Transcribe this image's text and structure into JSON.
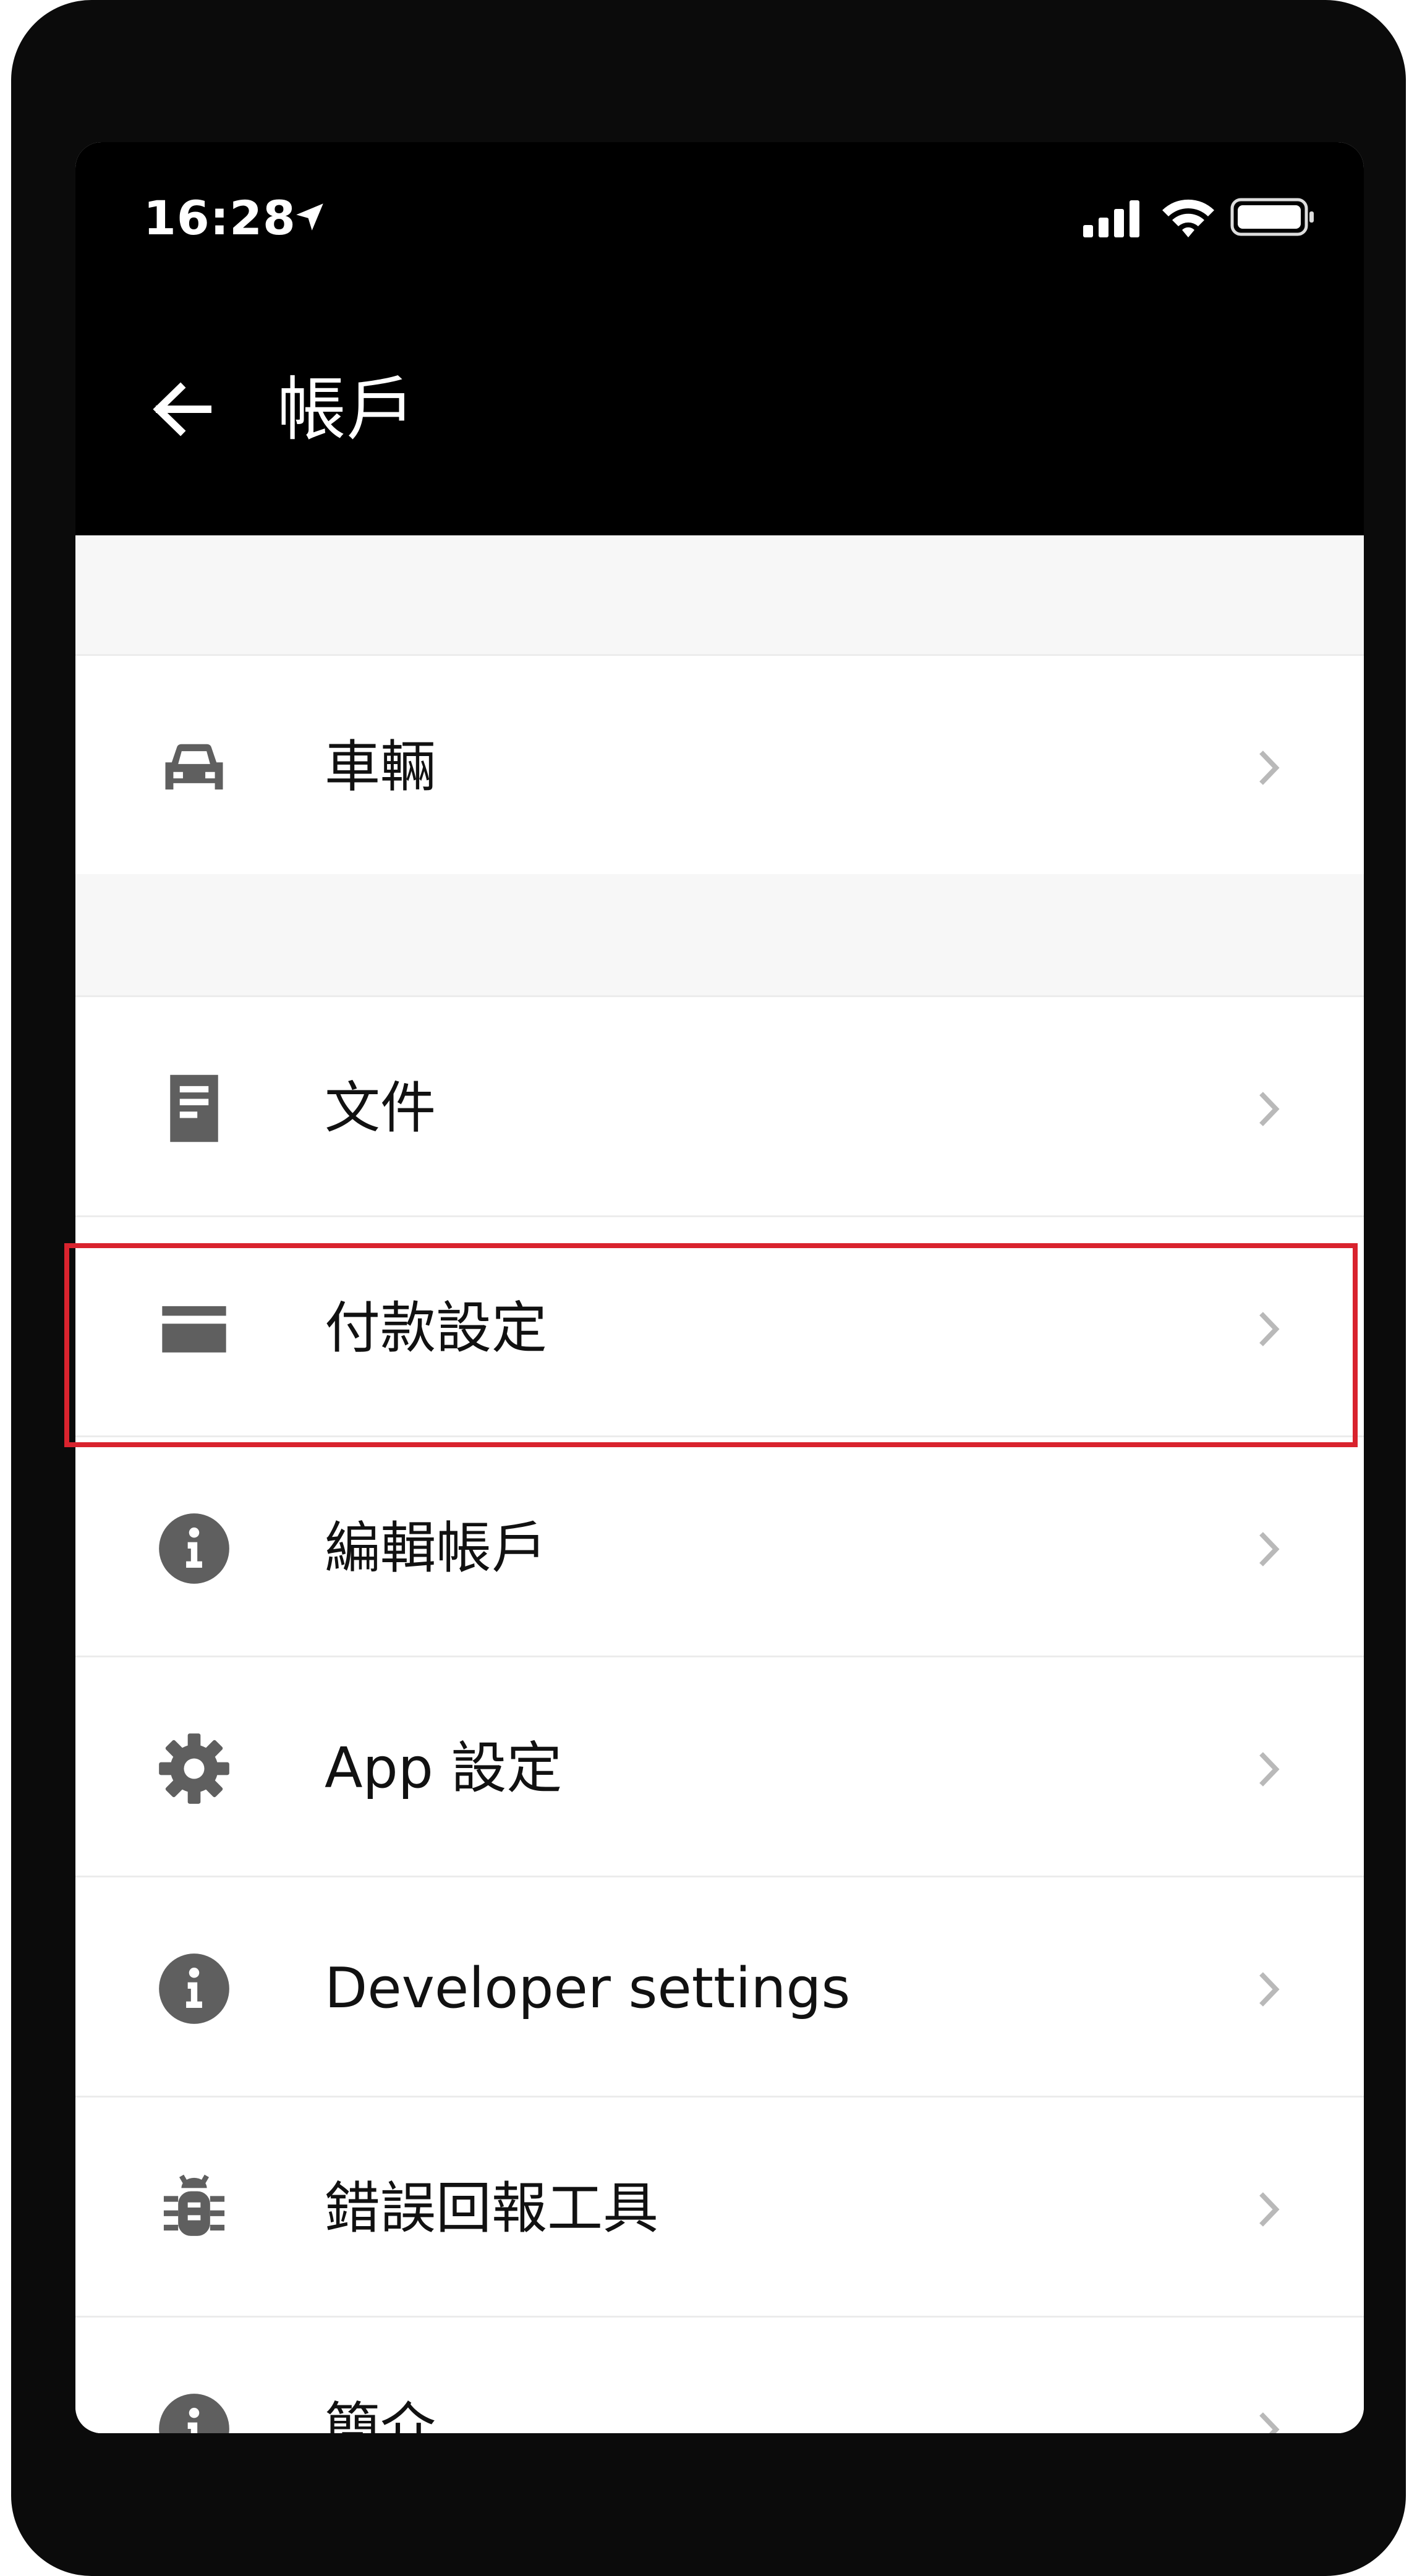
{
  "status_bar": {
    "time": "16:28"
  },
  "header": {
    "title": "帳戶"
  },
  "menu": {
    "items": [
      {
        "label": "車輛",
        "icon": "car-icon"
      },
      {
        "label": "文件",
        "icon": "document-icon"
      },
      {
        "label": "付款設定",
        "icon": "credit-card-icon"
      },
      {
        "label": "編輯帳戶",
        "icon": "info-icon"
      },
      {
        "label": "App 設定",
        "icon": "gear-icon"
      },
      {
        "label": "Developer settings",
        "icon": "info-icon"
      },
      {
        "label": "錯誤回報工具",
        "icon": "bug-icon"
      },
      {
        "label": "簡介",
        "icon": "info-icon"
      }
    ]
  },
  "colors": {
    "header_bg": "#000000",
    "icon_gray": "#5f5f5f",
    "chevron_gray": "#b9b9b9",
    "highlight_red": "#d9232e",
    "section_bg": "#f7f7f7"
  }
}
